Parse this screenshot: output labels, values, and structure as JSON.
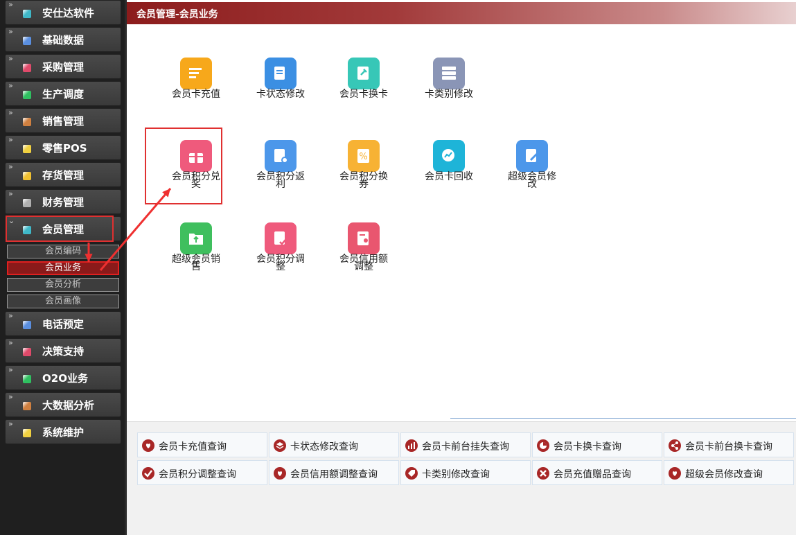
{
  "sidebar": {
    "items": [
      {
        "label": "安仕达软件",
        "icon": "app-icon",
        "color": "#3fb8c8"
      },
      {
        "label": "基础数据",
        "icon": "database-icon",
        "color": "#5a8fe0"
      },
      {
        "label": "采购管理",
        "icon": "purchase-icon",
        "color": "#e04a6a"
      },
      {
        "label": "生产调度",
        "icon": "production-icon",
        "color": "#2fc060"
      },
      {
        "label": "销售管理",
        "icon": "sales-icon",
        "color": "#d08040"
      },
      {
        "label": "零售POS",
        "icon": "pos-icon",
        "color": "#f0d040"
      },
      {
        "label": "存货管理",
        "icon": "inventory-icon",
        "color": "#f0c030"
      },
      {
        "label": "财务管理",
        "icon": "finance-icon",
        "color": "#b0b0b0"
      },
      {
        "label": "会员管理",
        "icon": "member-icon",
        "color": "#3fb8c8"
      },
      {
        "label": "电话预定",
        "icon": "phone-icon",
        "color": "#5a8fe0"
      },
      {
        "label": "决策支持",
        "icon": "decision-icon",
        "color": "#e04a6a"
      },
      {
        "label": "O2O业务",
        "icon": "o2o-icon",
        "color": "#2fc060"
      },
      {
        "label": "大数据分析",
        "icon": "bigdata-icon",
        "color": "#d08040"
      },
      {
        "label": "系统维护",
        "icon": "settings-icon",
        "color": "#f0d040"
      }
    ],
    "submenu": [
      "会员编码",
      "会员业务",
      "会员分析",
      "会员画像"
    ],
    "active_sub": "会员业务"
  },
  "header": {
    "title": "会员管理-会员业务"
  },
  "tiles": [
    {
      "label": "会员卡充值",
      "icon": "recharge-icon",
      "color": "#f7a81b"
    },
    {
      "label": "卡状态修改",
      "icon": "edit-doc-icon",
      "color": "#3b8fe3"
    },
    {
      "label": "会员卡换卡",
      "icon": "pin-icon",
      "color": "#37c7b7"
    },
    {
      "label": "卡类别修改",
      "icon": "server-icon",
      "color": "#8a95b6"
    },
    {
      "label": "会员积分兑奖",
      "icon": "gift-icon",
      "color": "#ef5a7c"
    },
    {
      "label": "会员积分返利",
      "icon": "doc-gear-icon",
      "color": "#4c97ea"
    },
    {
      "label": "会员积分换券",
      "icon": "percent-icon",
      "color": "#f7b234"
    },
    {
      "label": "会员卡回收",
      "icon": "chart-search-icon",
      "color": "#1eb4d8"
    },
    {
      "label": "超级会员修改",
      "icon": "edit-note-icon",
      "color": "#4c97ea"
    },
    {
      "label": "超级会员销售",
      "icon": "folder-up-icon",
      "color": "#3fbf5e"
    },
    {
      "label": "会员积分调整",
      "icon": "doc-check-icon",
      "color": "#ef5a7c"
    },
    {
      "label": "会员信用额调整",
      "icon": "doc-user-icon",
      "color": "#e9566f"
    }
  ],
  "queries": [
    {
      "label": "会员卡充值查询",
      "icon": "hearts-icon"
    },
    {
      "label": "卡状态修改查询",
      "icon": "layers-icon"
    },
    {
      "label": "会员卡前台挂失查询",
      "icon": "bars-icon"
    },
    {
      "label": "会员卡换卡查询",
      "icon": "pie-icon"
    },
    {
      "label": "会员卡前台换卡查询",
      "icon": "network-icon"
    },
    {
      "label": "会员积分调整查询",
      "icon": "check-icon"
    },
    {
      "label": "会员信用额调整查询",
      "icon": "hearts-icon"
    },
    {
      "label": "卡类别修改查询",
      "icon": "tag-icon"
    },
    {
      "label": "会员充值赠品查询",
      "icon": "x-icon"
    },
    {
      "label": "超级会员修改查询",
      "icon": "hearts-icon"
    }
  ]
}
